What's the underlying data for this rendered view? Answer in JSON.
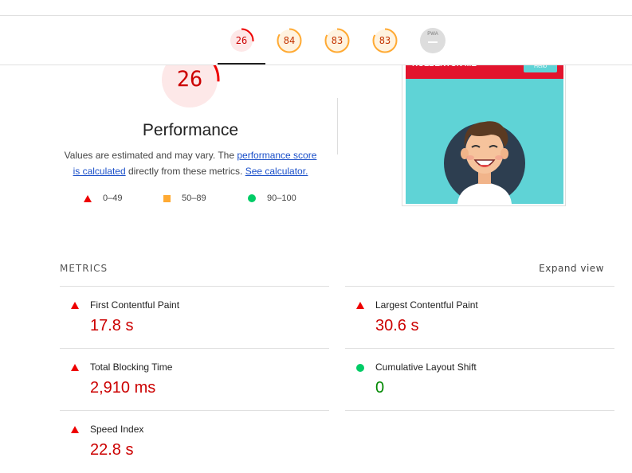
{
  "categories": [
    {
      "name": "performance-gauge",
      "score": "26",
      "color": "#e00",
      "bg": "#fde8e8"
    },
    {
      "name": "accessibility-gauge",
      "score": "84",
      "color": "#fa3",
      "bg": "#fff3e0"
    },
    {
      "name": "best-practices-gauge",
      "score": "83",
      "color": "#fa3",
      "bg": "#fff3e0"
    },
    {
      "name": "seo-gauge",
      "score": "83",
      "color": "#fa3",
      "bg": "#fff3e0"
    }
  ],
  "pwa": {
    "label": "PWA"
  },
  "performance": {
    "score": "26",
    "score_fraction": 0.26,
    "title": "Performance",
    "desc_prefix": "Values are estimated and may vary. The ",
    "desc_link": "performance score is calculated",
    "desc_mid": " directly from these metrics. ",
    "desc_link2": "See calculator."
  },
  "legend": [
    {
      "range": "0–49",
      "icon": "triangle-icon"
    },
    {
      "range": "50–89",
      "icon": "square-icon"
    },
    {
      "range": "90–100",
      "icon": "circle-icon"
    }
  ],
  "screenshot": {
    "brand": "HOLBERTON ME",
    "button": "Hello"
  },
  "metrics": {
    "title": "METRICS",
    "expand": "Expand view",
    "items": [
      {
        "label": "First Contentful Paint",
        "value": "17.8 s",
        "status": "fail"
      },
      {
        "label": "Largest Contentful Paint",
        "value": "30.6 s",
        "status": "fail"
      },
      {
        "label": "Total Blocking Time",
        "value": "2,910 ms",
        "status": "fail"
      },
      {
        "label": "Cumulative Layout Shift",
        "value": "0",
        "status": "pass"
      },
      {
        "label": "Speed Index",
        "value": "22.8 s",
        "status": "fail"
      }
    ]
  },
  "colors": {
    "fail": "#e00",
    "average": "#fa3",
    "pass": "#0c6"
  }
}
